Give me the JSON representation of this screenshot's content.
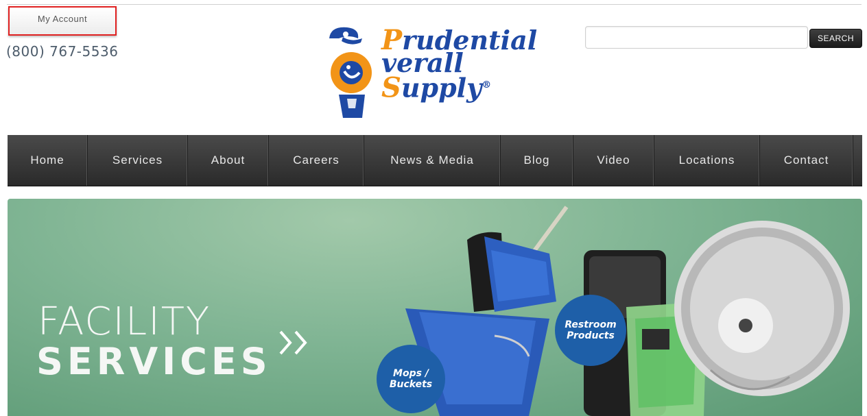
{
  "header": {
    "account_label": "My Account",
    "phone": "(800) 767-5536",
    "logo": {
      "line1_cap": "P",
      "line1_rest": "rudential",
      "line2_rest": "verall",
      "line3_cap": "S",
      "line3_rest": "upply",
      "registered": "®"
    },
    "search": {
      "value": "",
      "placeholder": "",
      "button_label": "SEARCH"
    }
  },
  "nav": {
    "items": [
      {
        "label": "Home"
      },
      {
        "label": "Services"
      },
      {
        "label": "About"
      },
      {
        "label": "Careers"
      },
      {
        "label": "News & Media"
      },
      {
        "label": "Blog"
      },
      {
        "label": "Video"
      },
      {
        "label": "Locations"
      },
      {
        "label": "Contact"
      }
    ]
  },
  "hero": {
    "title_line1": "FACILITY",
    "title_line2": "SERVICES",
    "badges": {
      "restroom_line1": "Restroom",
      "restroom_line2": "Products",
      "mops_line1": "Mops /",
      "mops_line2": "Buckets"
    }
  },
  "colors": {
    "logo_blue": "#1e49a4",
    "logo_orange": "#f29417",
    "nav_bg": "#333333",
    "hero_green": "#7fb493",
    "badge_blue": "#1e5fa8",
    "highlight_red": "#e02020"
  },
  "icons": {
    "logo_figure": "mascot-icon",
    "hero_arrow": "double-chevron-right-icon"
  }
}
